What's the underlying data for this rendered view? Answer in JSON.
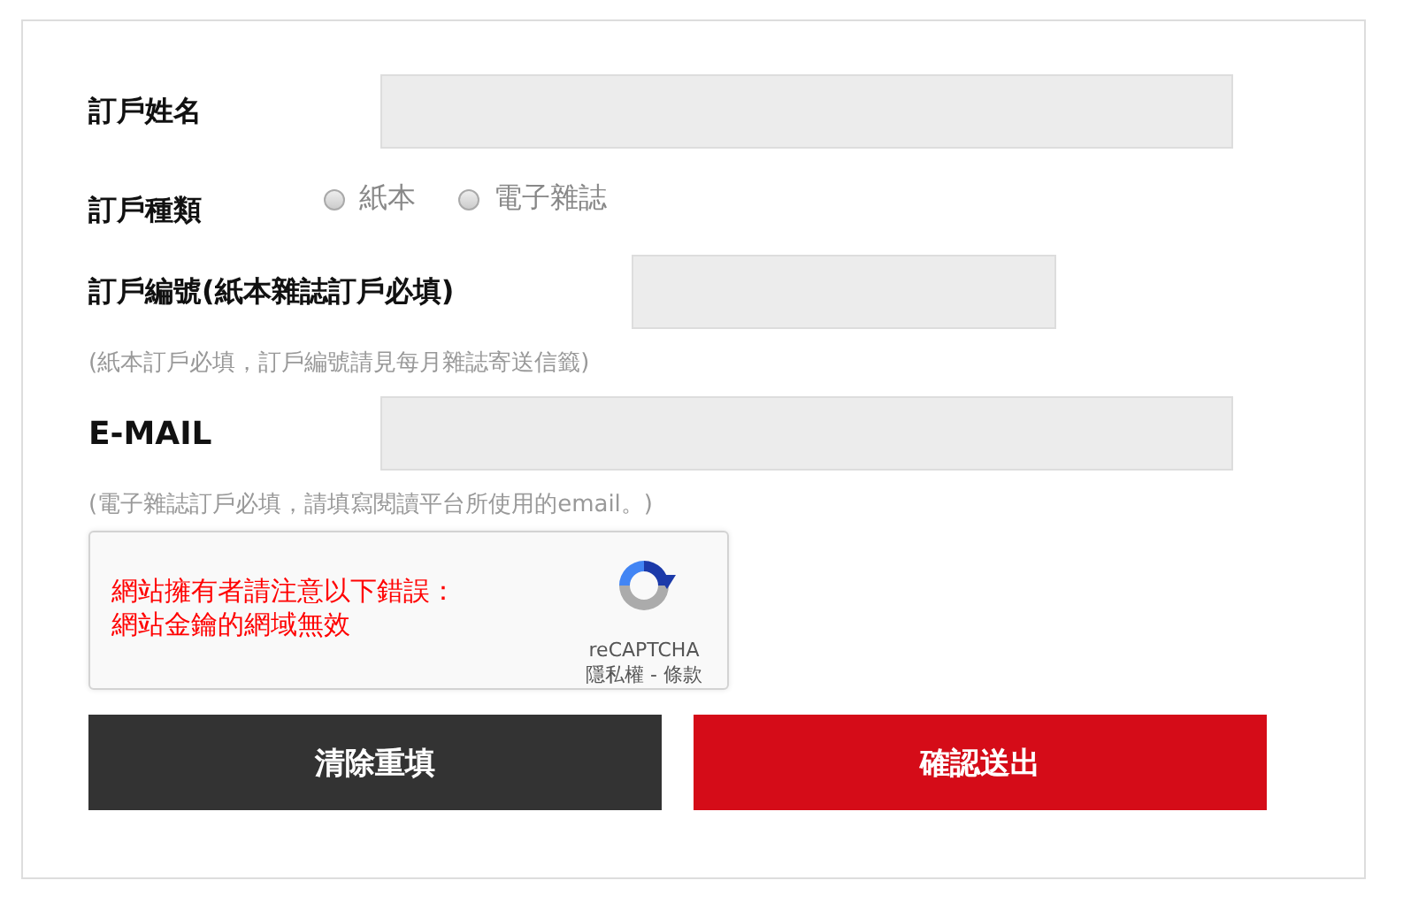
{
  "form": {
    "name_field": {
      "label": "訂戶姓名"
    },
    "type_field": {
      "label": "訂戶種類",
      "options": [
        {
          "label": "紙本",
          "selected": false
        },
        {
          "label": "電子雜誌",
          "selected": false
        }
      ]
    },
    "number_field": {
      "label": "訂戶編號(紙本雜誌訂戶必填)",
      "hint": "(紙本訂戶必填，訂戶編號請見每月雜誌寄送信籤)"
    },
    "email_field": {
      "label": "E-MAIL",
      "hint": "(電子雜誌訂戶必填，請填寫閱讀平台所使用的email。)"
    },
    "captcha": {
      "error_lines": [
        "網站擁有者請注意以下錯誤：",
        "網站金鑰的網域無效"
      ],
      "brand": "reCAPTCHA",
      "links": "隱私權 - 條款"
    },
    "buttons": [
      {
        "label": "清除重填",
        "kind": "reset"
      },
      {
        "label": "確認送出",
        "kind": "submit"
      }
    ]
  }
}
